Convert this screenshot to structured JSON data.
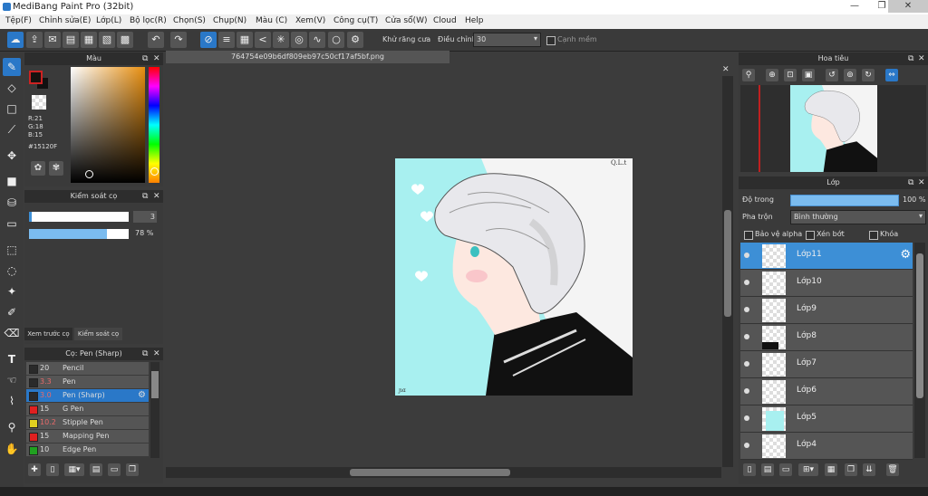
{
  "window": {
    "title": "MediBang Paint Pro (32bit)",
    "minimize": "—",
    "maximize": "❐",
    "close": "✕"
  },
  "menu": [
    "Tệp(F)",
    "Chỉnh sửa(E)",
    "Lớp(L)",
    "Bộ lọc(R)",
    "Chọn(S)",
    "Chụp(N)",
    "Màu (C)",
    "Xem(V)",
    "Công cụ(T)",
    "Cửa sổ(W)",
    "Cloud",
    "Help"
  ],
  "toolbar": {
    "antialias_label": "Khử răng cưa",
    "antialias_checked": true,
    "adjust_label": "Điều chỉnh",
    "adjust_value": "30",
    "edge_label": "Cạnh mềm"
  },
  "color_panel": {
    "title": "Màu",
    "r": "R:21",
    "g": "G:18",
    "b": "B:15",
    "hex": "#15120F",
    "accent": "#cc2222"
  },
  "brush_control": {
    "title": "Kiểm soát cọ",
    "size_value": "3",
    "opacity_value": "78 %",
    "opacity_fraction": 0.78
  },
  "tabs": {
    "preview": "Xem trước cọ",
    "control": "Kiểm soát cọ"
  },
  "brush_list": {
    "title": "Cọ: Pen (Sharp)",
    "items": [
      {
        "size": "20",
        "name": "Pencil",
        "color": "#2a2a2a"
      },
      {
        "size": "3.3",
        "name": "Pen",
        "color": "#2a2a2a"
      },
      {
        "size": "3.0",
        "name": "Pen (Sharp)",
        "color": "#2a2a2a"
      },
      {
        "size": "15",
        "name": "G Pen",
        "color": "#e02020"
      },
      {
        "size": "10.2",
        "name": "Stipple Pen",
        "color": "#e0d020"
      },
      {
        "size": "15",
        "name": "Mapping Pen",
        "color": "#e02020"
      },
      {
        "size": "10",
        "name": "Edge Pen",
        "color": "#20a020"
      }
    ]
  },
  "document": {
    "tab_name": "764754e09b6df809eb97c50cf17af5bf.png",
    "signature": "Q.L.t",
    "corner_mark": "ɲɑ"
  },
  "navigator": {
    "title": "Hoa tiêu"
  },
  "layers": {
    "title": "Lớp",
    "opacity_label": "Độ trong",
    "opacity_value": "100 %",
    "blend_label": "Pha trộn",
    "blend_value": "Bình thường",
    "protect_alpha": "Bảo vệ alpha",
    "clipping": "Xén bớt",
    "lock": "Khóa",
    "items": [
      "Lớp11",
      "Lớp10",
      "Lớp9",
      "Lớp8",
      "Lớp7",
      "Lớp6",
      "Lớp5",
      "Lớp4"
    ]
  }
}
